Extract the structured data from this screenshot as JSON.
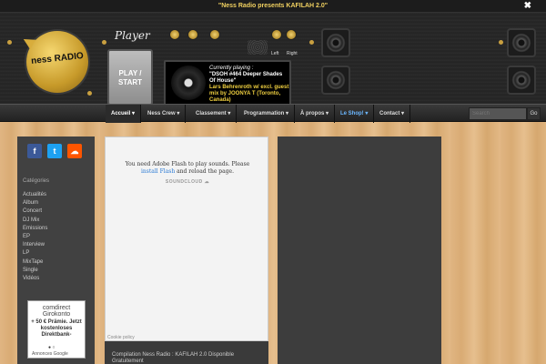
{
  "topbar": {
    "message": "\"Ness Radio presents KAFILAH 2.0\"",
    "close_glyph": "✖"
  },
  "header": {
    "logo_text": "ness RADIO",
    "player_title": "Player",
    "play_button": "PLAY / START",
    "left_label": "Left",
    "right_label": "Right",
    "now_playing": {
      "label": "Currently playing :",
      "track": "\"DSOH #464 Deeper Shades Of House\"",
      "artist": "Lars Behrenroth w/ excl. guest mix by JOONYA T (Toronto, Canada)"
    }
  },
  "nav": {
    "items": [
      "Accueil ▾",
      "Ness Crew ▾",
      "Classement ▾",
      "Programmation ▾",
      "À propos ▾",
      "Le Shop! ▾",
      "Contact ▾"
    ],
    "search_placeholder": "Search",
    "go_label": "Go"
  },
  "sidebar": {
    "social": {
      "facebook": "f",
      "twitter": "t",
      "soundcloud": "☁"
    },
    "categories_title": "Catégories",
    "categories": [
      "Actualités",
      "Album",
      "Concert",
      "DJ Mix",
      "Emissions",
      "EP",
      "Interview",
      "LP",
      "MixTape",
      "Single",
      "Vidéos"
    ],
    "ad": {
      "brand": "comdirect Girokonto",
      "text": "+ 50 € Prämie. Jetzt kostenloses Direktbank-",
      "dots": "● ○",
      "footer": "Annonces Google"
    }
  },
  "content": {
    "flash_message": "You need Adobe Flash to play sounds. Please",
    "flash_link": "install Flash",
    "flash_message_end": " and reload the page.",
    "soundcloud_label": "SOUNDCLOUD ☁",
    "cookie_policy": "Cookie policy",
    "footer_text": "Compilation Ness Radio : KAFILAH 2.0 Disponible Gratuitement"
  },
  "colors": {
    "accent_gold": "#f0d040",
    "shop_link": "#6bb7ff",
    "facebook": "#3b5998",
    "twitter": "#1da1f2",
    "soundcloud": "#ff5500"
  }
}
